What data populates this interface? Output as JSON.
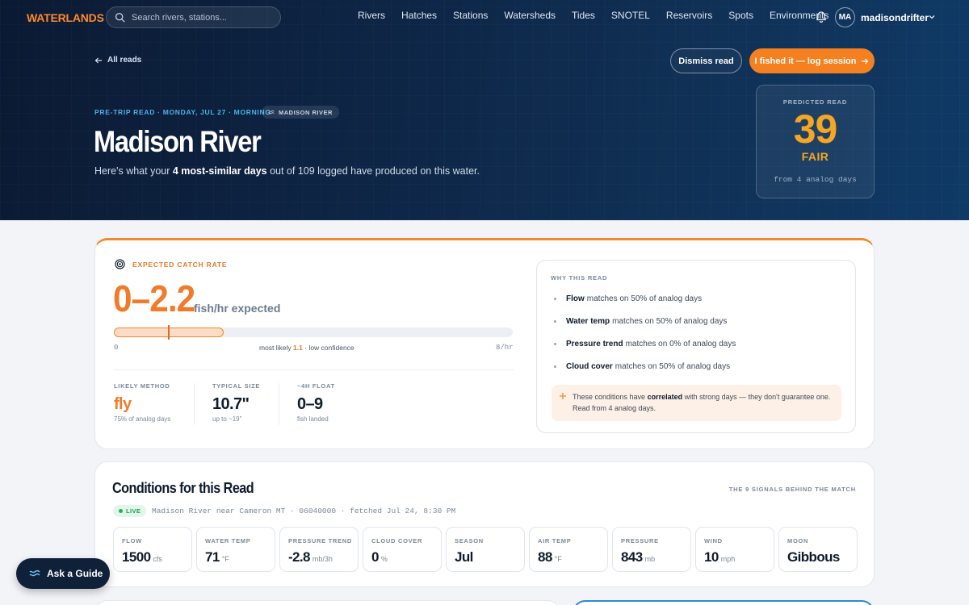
{
  "nav": {
    "logo": "WATERLANDS",
    "search_placeholder": "Search rivers, stations...",
    "links": [
      "Rivers",
      "Hatches",
      "Stations",
      "Watersheds",
      "Tides",
      "SNOTEL",
      "Reservoirs",
      "Spots",
      "Environments"
    ],
    "avatar_initials": "MA",
    "username": "madisondrifter"
  },
  "hero": {
    "back_label": "All reads",
    "dismiss_label": "Dismiss read",
    "log_label": "I fished it — log session",
    "eyebrow": "PRE-TRIP READ · MONDAY, JUL 27 · MORNING",
    "river_chip": "MADISON RIVER",
    "title": "Madison River",
    "subtitle_prefix": "Here's what your ",
    "subtitle_bold": "4 most-similar days",
    "subtitle_suffix": " out of 109 logged have produced on this water."
  },
  "predicted": {
    "label": "PREDICTED READ",
    "score": "39",
    "grade": "FAIR",
    "from": "from 4 analog days"
  },
  "catch": {
    "header": "EXPECTED CATCH RATE",
    "rate": "0–2.2",
    "unit": "fish/hr expected",
    "range_min": "0",
    "range_max": "8/hr",
    "most_likely_prefix": "most likely ",
    "most_likely_value": "1.1",
    "most_likely_suffix": " · low confidence",
    "range_low": 0,
    "range_high": 2.2,
    "scale_max": 8,
    "most_likely": 1.1,
    "stats": [
      {
        "label": "LIKELY METHOD",
        "value": "fly",
        "sub": "75% of analog days"
      },
      {
        "label": "TYPICAL SIZE",
        "value": "10.7\"",
        "sub": "up to ~19\""
      },
      {
        "label": "~4H FLOAT",
        "value": "0–9",
        "sub": "fish landed"
      }
    ]
  },
  "why": {
    "title": "WHY THIS READ",
    "rows": [
      {
        "bold": "Flow",
        "text": "matches on 50% of analog days"
      },
      {
        "bold": "Water temp",
        "text": "matches on 50% of analog days"
      },
      {
        "bold": "Pressure trend",
        "text": "matches on 0% of analog days"
      },
      {
        "bold": "Cloud cover",
        "text": "matches on 50% of analog days"
      }
    ],
    "note_prefix": "These conditions have ",
    "note_bold": "correlated",
    "note_suffix": " with strong days — they don't guarantee one. Read from 4 analog days."
  },
  "conditions": {
    "title": "Conditions for this Read",
    "right_label": "THE 9 SIGNALS BEHIND THE MATCH",
    "live": "LIVE",
    "source": "Madison River near Cameron MT · 06040000 · fetched Jul 24, 8:30 PM",
    "tiles": [
      {
        "label": "FLOW",
        "value": "1500",
        "unit": "cfs"
      },
      {
        "label": "WATER TEMP",
        "value": "71",
        "unit": "°F"
      },
      {
        "label": "PRESSURE TREND",
        "value": "-2.8",
        "unit": "mb/3h"
      },
      {
        "label": "CLOUD COVER",
        "value": "0",
        "unit": "%"
      },
      {
        "label": "SEASON",
        "value": "Jul",
        "unit": ""
      },
      {
        "label": "AIR TEMP",
        "value": "88",
        "unit": "°F"
      },
      {
        "label": "PRESSURE",
        "value": "843",
        "unit": "mb"
      },
      {
        "label": "WIND",
        "value": "10",
        "unit": "mph"
      },
      {
        "label": "MOON",
        "value": "Gibbous",
        "unit": ""
      }
    ]
  },
  "guide": {
    "label": "Ask a Guide"
  },
  "colors": {
    "accent": "#f4801f",
    "hero_bg": "#0e2748",
    "score": "#f5a623",
    "live": "#1f9d55"
  }
}
